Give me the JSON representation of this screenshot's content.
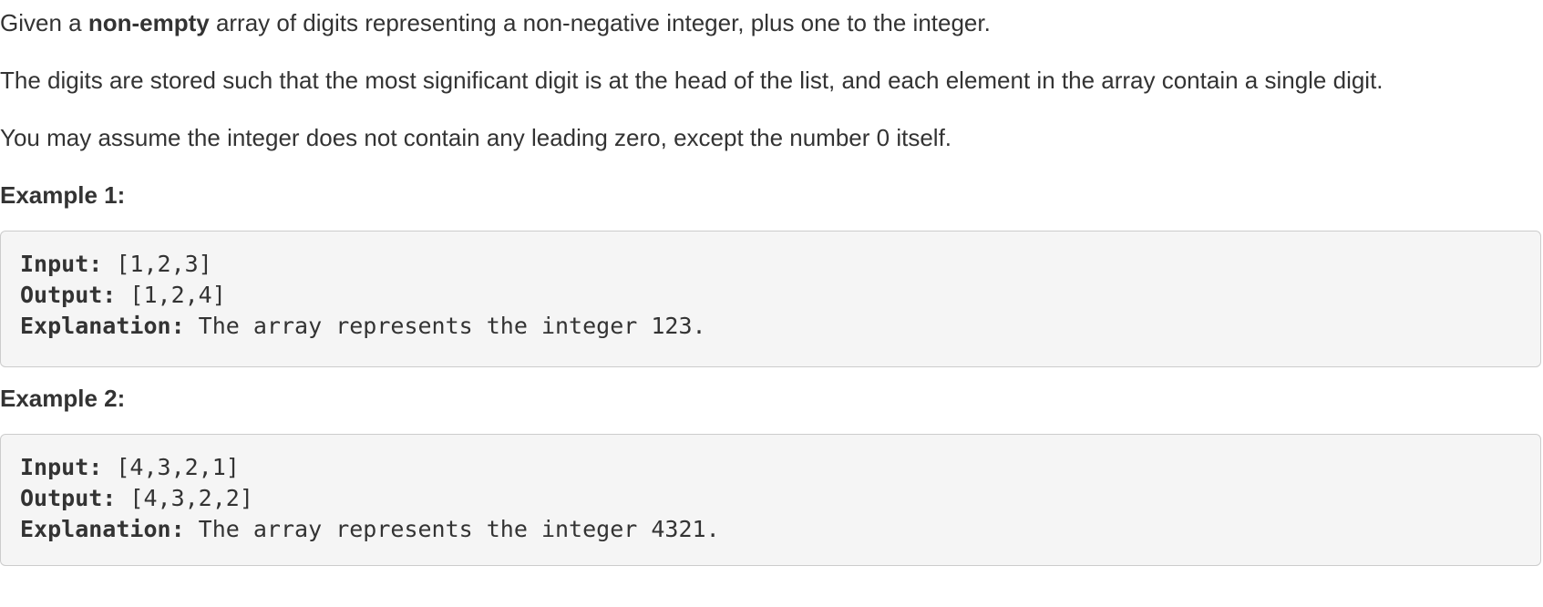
{
  "intro": {
    "p1_before": "Given a ",
    "p1_bold": "non-empty",
    "p1_after": " array of digits representing a non-negative integer, plus one to the integer.",
    "p2": "The digits are stored such that the most significant digit is at the head of the list, and each element in the array contain a single digit.",
    "p3": "You may assume the integer does not contain any leading zero, except the number 0 itself."
  },
  "examples": [
    {
      "heading": "Example 1:",
      "input_label": "Input:",
      "input_value": " [1,2,3]",
      "output_label": "Output:",
      "output_value": " [1,2,4]",
      "explanation_label": "Explanation:",
      "explanation_value": " The array represents the integer 123."
    },
    {
      "heading": "Example 2:",
      "input_label": "Input:",
      "input_value": " [4,3,2,1]",
      "output_label": "Output:",
      "output_value": " [4,3,2,2]",
      "explanation_label": "Explanation:",
      "explanation_value": " The array represents the integer 4321."
    }
  ],
  "colors": {
    "text": "#333333",
    "code_background": "#f5f5f5",
    "code_border": "#cccccc"
  }
}
